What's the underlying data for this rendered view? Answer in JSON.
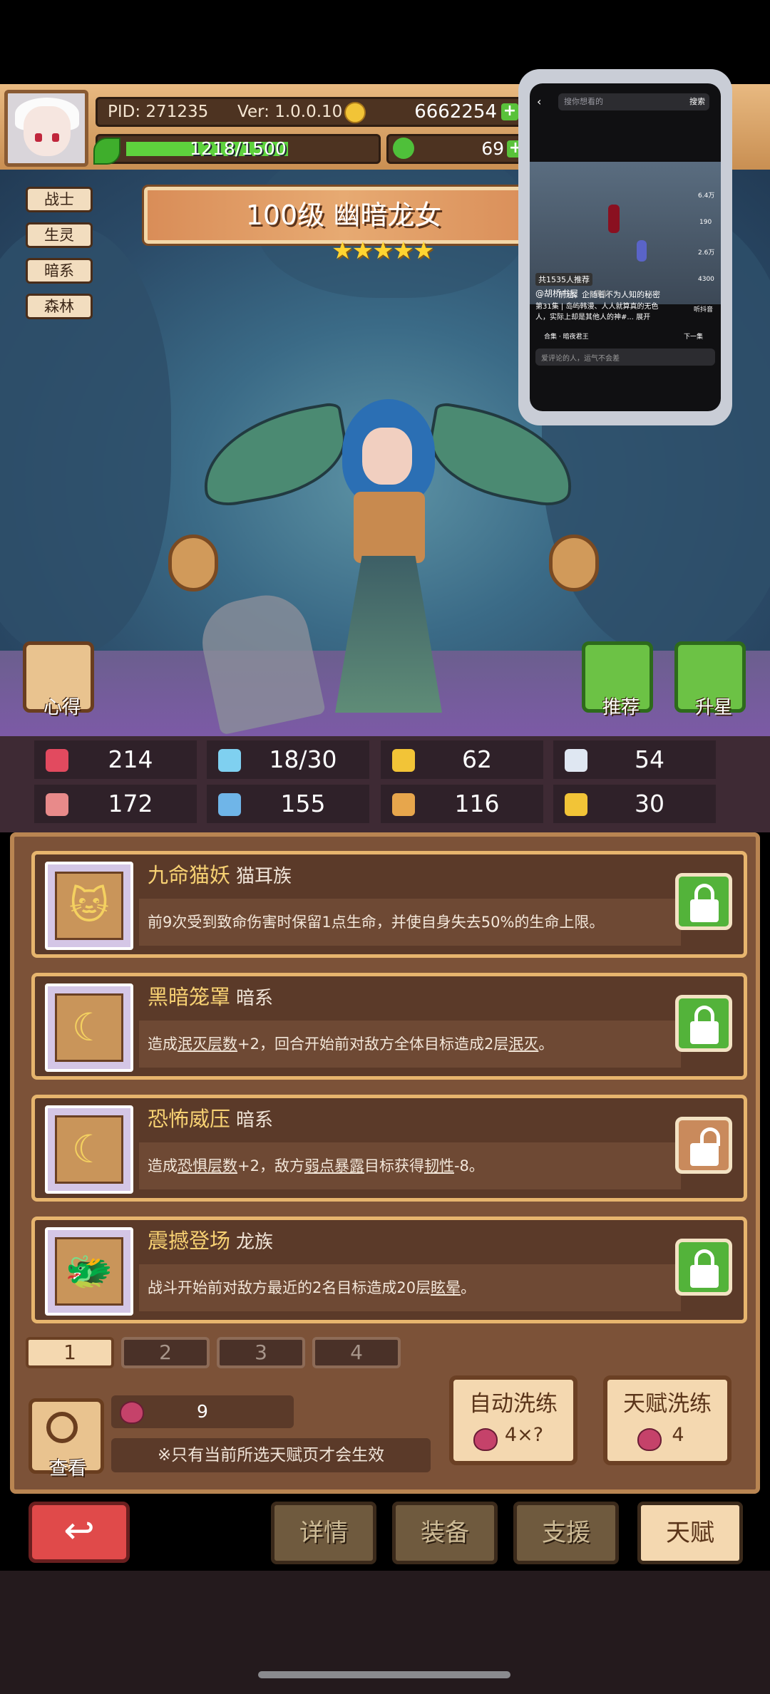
{
  "header": {
    "pid": "PID: 271235",
    "version": "Ver: 1.0.0.10",
    "gold": "6662254",
    "hp": "1218/1500",
    "hp_fraction": 0.81,
    "gems": "69"
  },
  "hero": {
    "tags": [
      "战士",
      "生灵",
      "暗系",
      "森林"
    ],
    "name": "100级 幽暗龙女",
    "stars": "★★★★★",
    "left_button": "心得",
    "right_buttons": [
      "推荐",
      "升星"
    ]
  },
  "stats": [
    {
      "icon": "heart-icon",
      "value": "214",
      "color": "#e24a5f"
    },
    {
      "icon": "drop-icon",
      "value": "18/30",
      "color": "#7fd0f0"
    },
    {
      "icon": "shield-icon",
      "value": "62",
      "color": "#f2c437"
    },
    {
      "icon": "wing-icon",
      "value": "54",
      "color": "#dfe7f2"
    },
    {
      "icon": "fist-icon",
      "value": "172",
      "color": "#e88a8a"
    },
    {
      "icon": "book-icon",
      "value": "155",
      "color": "#6fb5e8"
    },
    {
      "icon": "scroll-icon",
      "value": "116",
      "color": "#e7a64c"
    },
    {
      "icon": "horseshoe-icon",
      "value": "30",
      "color": "#f2c437"
    }
  ],
  "talents": [
    {
      "name": "九命猫妖",
      "group": "猫耳族",
      "glyph": "🐱",
      "locked": true,
      "desc": "前9次受到致命伤害时保留1点生命，并使自身失去50%的生命上限。"
    },
    {
      "name": "黑暗笼罩",
      "group": "暗系",
      "glyph": "☾",
      "locked": true,
      "desc": "造成泯灭层数+2，回合开始前对敌方全体目标造成2层泯灭。"
    },
    {
      "name": "恐怖威压",
      "group": "暗系",
      "glyph": "☾",
      "locked": false,
      "desc": "造成恐惧层数+2，敌方弱点暴露目标获得韧性-8。"
    },
    {
      "name": "震撼登场",
      "group": "龙族",
      "glyph": "🐲",
      "locked": true,
      "desc": "战斗开始前对敌方最近的2名目标造成20层眩晕。"
    }
  ],
  "pages": [
    "1",
    "2",
    "3",
    "4"
  ],
  "bottom": {
    "view_label": "查看",
    "resource": "9",
    "note": "※只有当前所选天赋页才会生效",
    "auto_reroll": "自动洗练",
    "auto_cost": "4×?",
    "talent_reroll": "天赋洗练",
    "talent_cost": "4"
  },
  "nav": [
    "详情",
    "装备",
    "支援",
    "天赋"
  ],
  "overlay": {
    "search_placeholder": "搜你想看的",
    "search_button": "搜索",
    "caption": "前后，企随着不为人知的秘密",
    "recommend": "共1535人推荐",
    "author": "@胡桥书屋",
    "time": "·1周前",
    "episode": "第31集 | 岛屿韩漫、人人就算真的无色人，实际上却是其他人的神#... 展开",
    "collection": "合集 · 暗夜君王",
    "next": "下一集",
    "comment_placeholder": "爱评论的人，运气不会差",
    "counts": [
      "6.4万",
      "190",
      "2.6万",
      "4300"
    ],
    "listen": "听抖音"
  }
}
